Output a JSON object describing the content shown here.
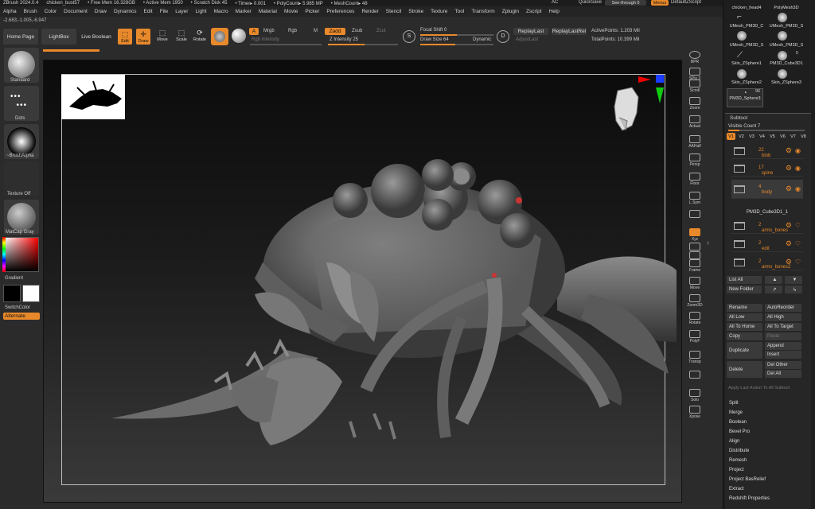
{
  "titlebar": {
    "app": "ZBrush 2024.0.4",
    "file": "chicken_bust57",
    "free_mem": "• Free Mem 16.328GB",
    "active_mem": "• Active Mem 1950",
    "scratch": "• Scratch Disk 45",
    "timer": "• Timer▸ 0.001",
    "polycount": "• PolyCount▸ 5.985 MP",
    "meshcount": "• MeshCount▸ 48",
    "ac": "AC",
    "quicksave": "QuickSave",
    "see_through": "See-through  0",
    "menus": "Menus",
    "default_script": "DefaultZScript"
  },
  "menubar": [
    "Alpha",
    "Brush",
    "Color",
    "Document",
    "Draw",
    "Dynamics",
    "Edit",
    "File",
    "Layer",
    "Light",
    "Macro",
    "Marker",
    "Material",
    "Movie",
    "Picker",
    "Preferences",
    "Render",
    "Stencil",
    "Stroke",
    "Texture",
    "Tool",
    "Transform",
    "Zplugin",
    "Zscript",
    "Help"
  ],
  "coords": "-2.683,-1.005,-6.947",
  "shelf": {
    "home_page": "Home Page",
    "lightbox": "LightBox",
    "live_boolean": "Live Boolean",
    "edit": "Edit",
    "draw": "Draw",
    "move": "Move",
    "scale": "Scale",
    "rotate": "Rotate",
    "a_label": "A",
    "mrgb": "Mrgb",
    "rgb": "Rgb",
    "m": "M",
    "rgb_intensity": "Rgb Intensity",
    "zadd": "Zadd",
    "zsub": "Zsub",
    "zcut": "Zcut",
    "z_intensity": "Z Intensity 25",
    "focal_shift": "Focal Shift 0",
    "draw_size": "Draw Size 64",
    "dynamic": "Dynamic",
    "replay_last": "ReplayLast",
    "replay_last_rel": "ReplayLastRel",
    "adjust_last": "AdjustLast",
    "active_points": "ActivePoints: 1.203 Mil",
    "total_points": "TotalPoints: 10.399 Mil"
  },
  "lefttray": {
    "standard": "Standard",
    "dots": "Dots",
    "brush_alpha": "~BrushAlpha",
    "texture_off": "Texture Off",
    "matcap_gray": "MatCap Gray",
    "gradient": "Gradient",
    "switch_color": "SwitchColor",
    "alternate": "Alternate"
  },
  "righttray": [
    "BPR",
    "SPix 3",
    "Scroll",
    "Zoom",
    "Actual",
    "AAHalf",
    "Persp",
    "Floor",
    "L.Sym",
    "",
    "Xyz",
    "",
    "",
    "Frame",
    "Move",
    "Zoom3D",
    "Rotate",
    "PolyF",
    "Transp",
    "",
    "Solo",
    "Xpose"
  ],
  "tool_palette": {
    "row0": [
      "chicken_head4",
      "PolyMesh3D"
    ],
    "row1": [
      "UMesh_PM3D_C",
      "UMesh_PM3D_S"
    ],
    "row2": [
      "UMesh_PM3D_S",
      "UMesh_PM3D_S"
    ],
    "row3": [
      "Skin_ZSphere1",
      "PM3D_Cube3D1"
    ],
    "row4": [
      "Skin_ZSphere2",
      "Skin_ZSphere3"
    ],
    "row5_count": "96",
    "row5": "PM3D_Sphere3",
    "row3_count": "5"
  },
  "subtool": {
    "title": "Subtool",
    "visible_count": "Visible Count 7",
    "versions": [
      "V1",
      "V2",
      "V3",
      "V4",
      "V5",
      "V6",
      "V7",
      "V8"
    ],
    "items": [
      {
        "num": "22",
        "name": "blob"
      },
      {
        "num": "17",
        "name": "spine"
      },
      {
        "num": "4",
        "name": "body"
      },
      {
        "num": "",
        "name": "PM3D_Cube3D1_1"
      },
      {
        "num": "2",
        "name": "arms_bones"
      },
      {
        "num": "2",
        "name": "edit"
      },
      {
        "num": "2",
        "name": "arms_bones2"
      }
    ],
    "list_all": "List All",
    "new_folder": "New Folder",
    "rename": "Rename",
    "auto_reorder": "AutoReorder",
    "all_low": "All Low",
    "all_high": "All High",
    "all_to_home": "All To Home",
    "all_to_target": "All To Target",
    "copy": "Copy",
    "paste": "Paste",
    "duplicate": "Duplicate",
    "append": "Append",
    "insert": "Insert",
    "delete": "Delete",
    "del_other": "Del Other",
    "del_all": "Del All",
    "apply_last": "Apply Last Action To All Subtool",
    "menu": [
      "Split",
      "Merge",
      "Boolean",
      "Bevel Pro",
      "Align",
      "Distribute",
      "Remesh",
      "Project",
      "Project BasRelief",
      "Extract",
      "Redshift Properties"
    ]
  },
  "colors": {
    "accent": "#e8892b",
    "panel": "#1e1e1e",
    "button": "#3a3a3a"
  }
}
